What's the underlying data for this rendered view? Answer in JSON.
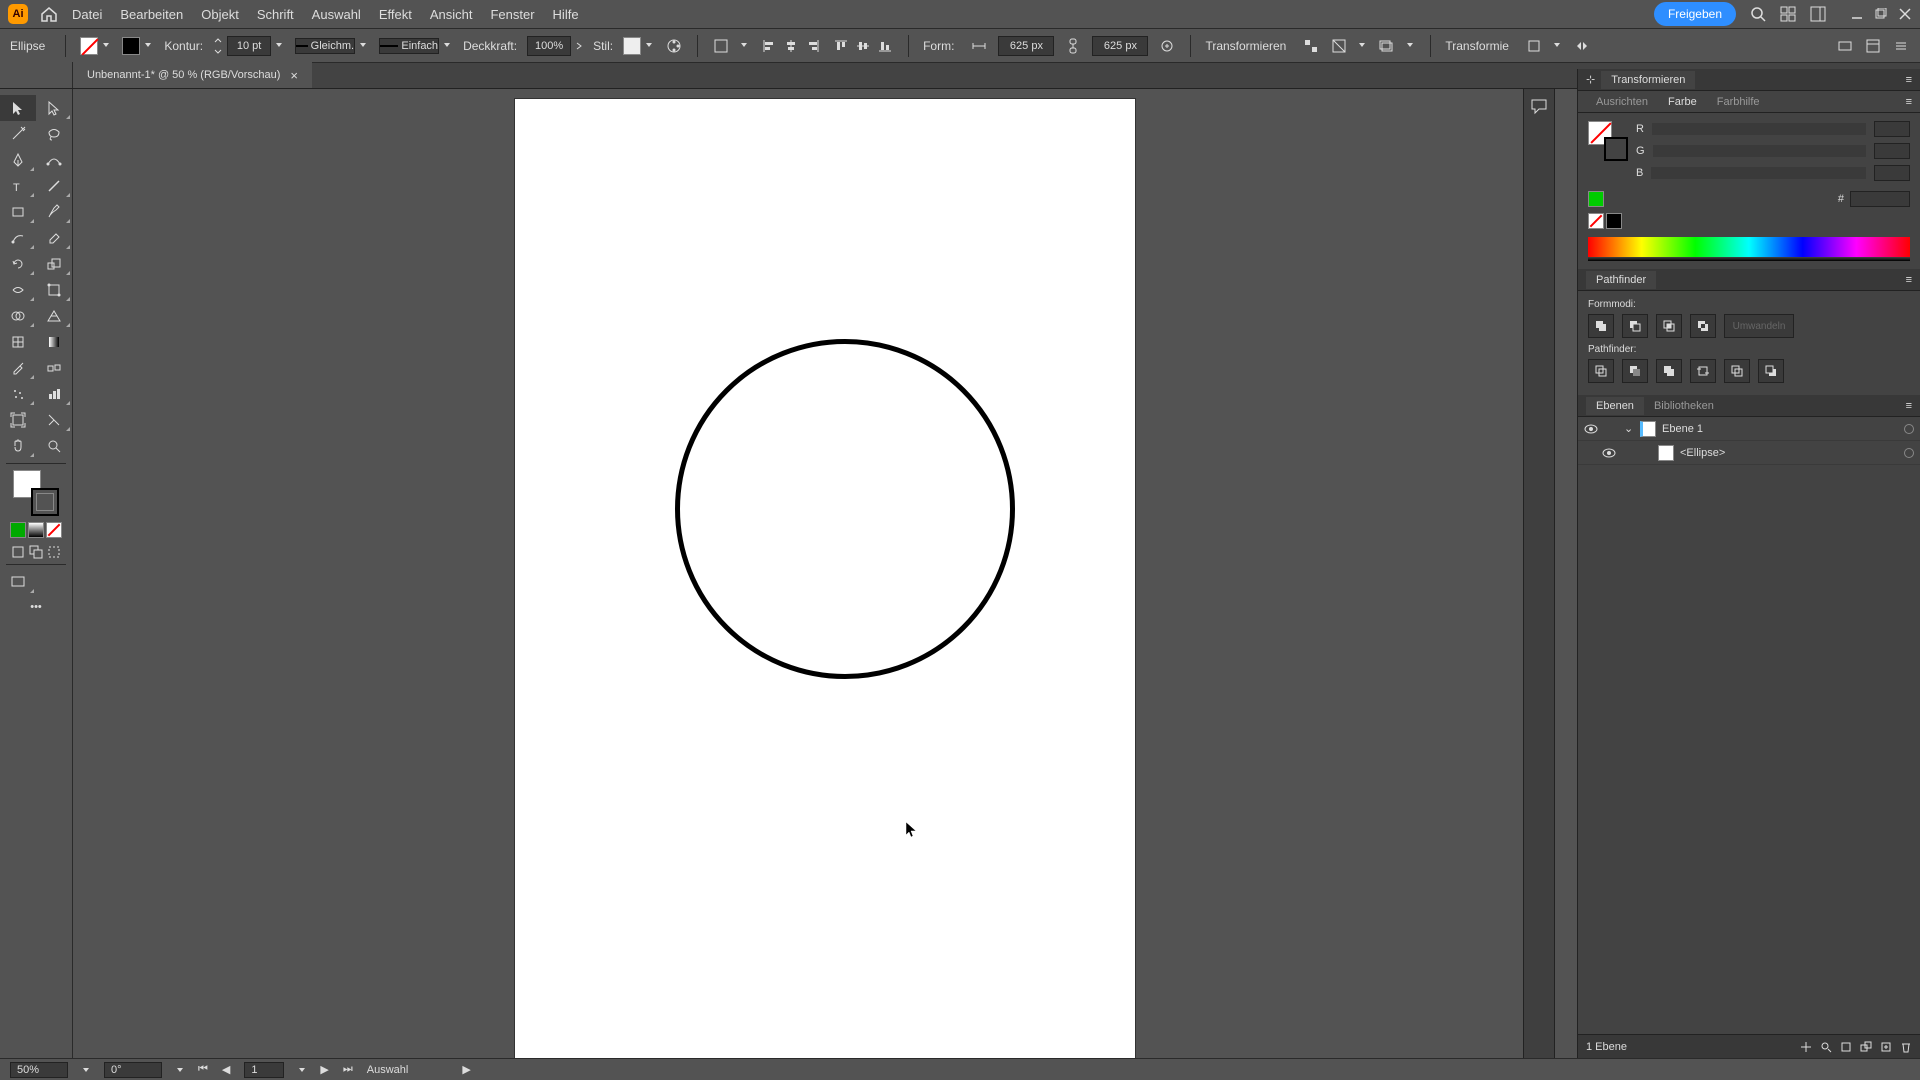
{
  "app_logo": "Ai",
  "menu": {
    "items": [
      "Datei",
      "Bearbeiten",
      "Objekt",
      "Schrift",
      "Auswahl",
      "Effekt",
      "Ansicht",
      "Fenster",
      "Hilfe"
    ],
    "share": "Freigeben"
  },
  "options": {
    "tool": "Ellipse",
    "kontur_lbl": "Kontur:",
    "kontur_val": "10 pt",
    "stroke_var": "Gleichm.",
    "stroke_prof": "Einfach",
    "deck_lbl": "Deckkraft:",
    "deck_val": "100%",
    "stil_lbl": "Stil:",
    "form_lbl": "Form:",
    "w_val": "625 px",
    "h_val": "625 px",
    "trans_btn": "Transformieren",
    "trans_lbl": "Transformie"
  },
  "doc": {
    "title": "Unbenannt-1* @ 50 % (RGB/Vorschau)"
  },
  "panels": {
    "transform": {
      "title": "Transformieren",
      "tabs": [
        "Ausrichten",
        "Farbe",
        "Farbhilfe"
      ],
      "active": "Farbe",
      "r": "R",
      "g": "G",
      "b": "B",
      "hex": "#"
    },
    "pathfinder": {
      "title": "Pathfinder",
      "mode": "Formmodi:",
      "pf": "Pathfinder:"
    },
    "layers": {
      "tabs": [
        "Ebenen",
        "Bibliotheken"
      ],
      "active": "Ebenen",
      "layer1": "Ebene 1",
      "item": "<Ellipse>",
      "count": "1 Ebene"
    }
  },
  "status": {
    "zoom": "50%",
    "rot": "0°",
    "art": "1",
    "sel": "Auswahl"
  }
}
